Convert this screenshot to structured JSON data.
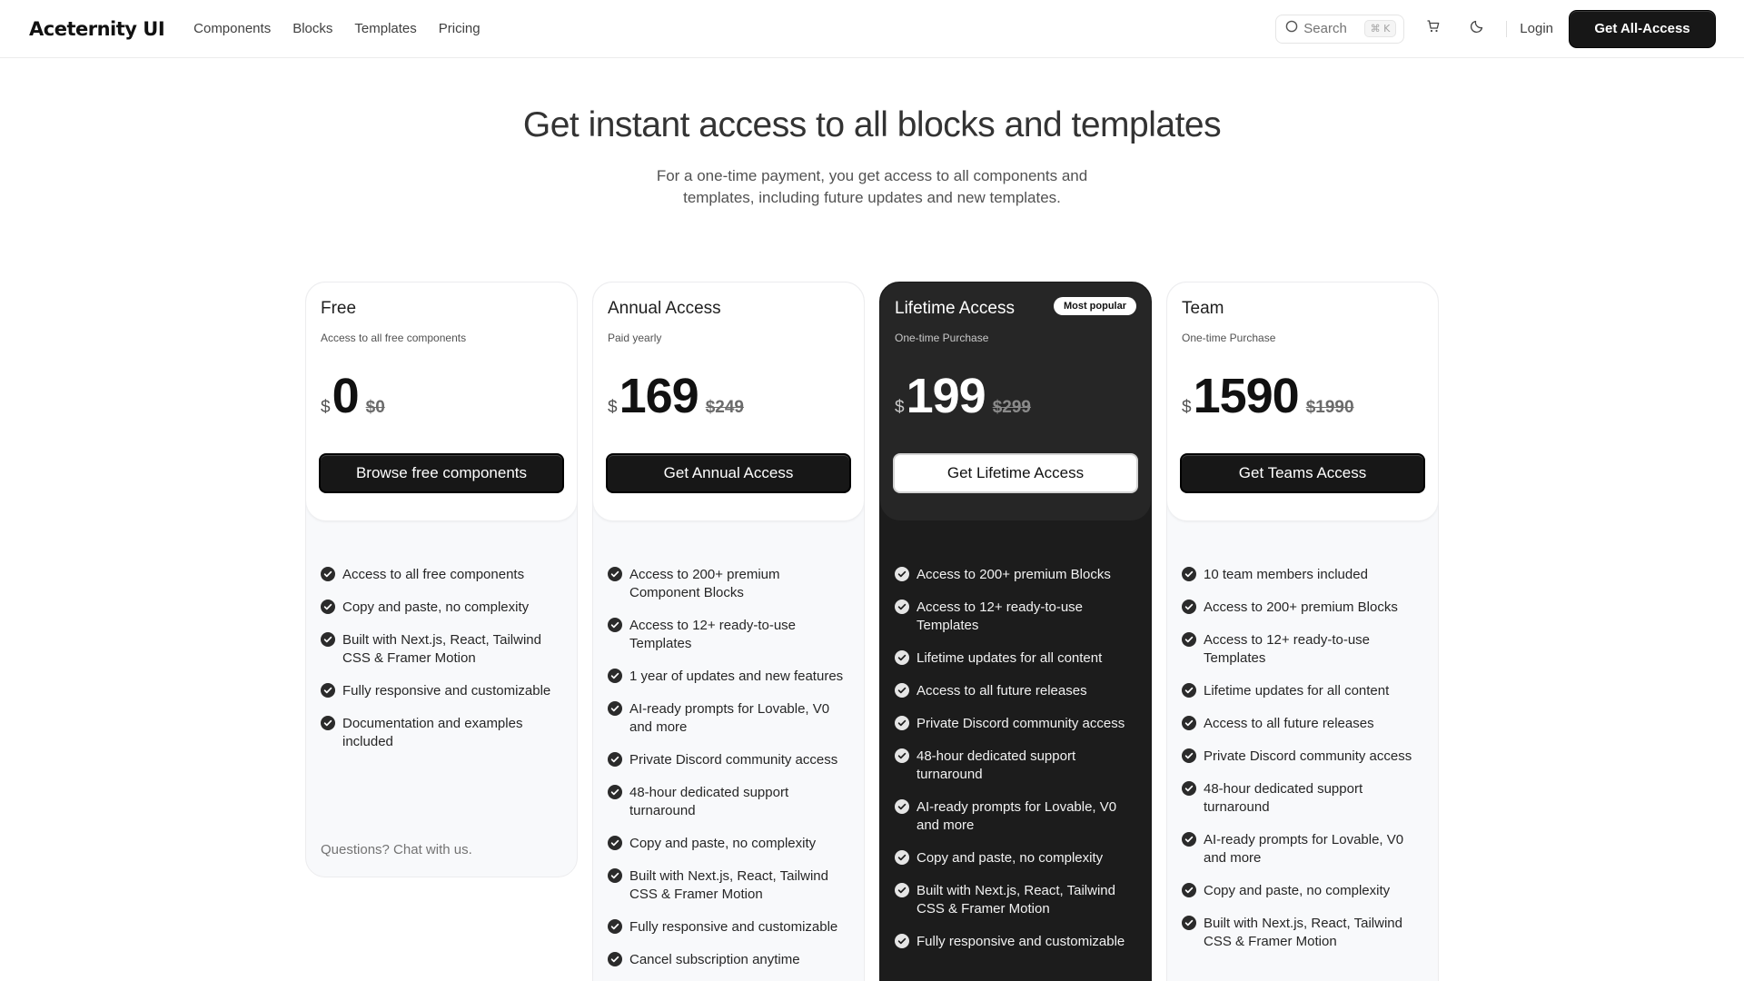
{
  "nav": {
    "logo": "Aceternity UI",
    "links": [
      "Components",
      "Blocks",
      "Templates",
      "Pricing"
    ],
    "search_label": "Search",
    "search_shortcut": "⌘ K",
    "login": "Login",
    "cta": "Get All-Access"
  },
  "hero": {
    "title": "Get instant access to all blocks and templates",
    "subtitle": "For a one-time payment, you get access to all components and templates, including future updates and new templates."
  },
  "plans": [
    {
      "name": "Free",
      "description": "Access to all free components",
      "currency": "$",
      "price": "0",
      "old_price": "$0",
      "button": "Browse free components",
      "features": [
        "Access to all free components",
        "Copy and paste, no complexity",
        "Built with Next.js, React, Tailwind CSS & Framer Motion",
        "Fully responsive and customizable",
        "Documentation and examples included"
      ],
      "footer": "Questions? Chat with us."
    },
    {
      "name": "Annual Access",
      "description": "Paid yearly",
      "currency": "$",
      "price": "169",
      "old_price": "$249",
      "button": "Get Annual Access",
      "features": [
        "Access to 200+ premium Component Blocks",
        "Access to 12+ ready-to-use Templates",
        "1 year of updates and new features",
        "AI-ready prompts for Lovable, V0 and more",
        "Private Discord community access",
        "48-hour dedicated support turnaround",
        "Copy and paste, no complexity",
        "Built with Next.js, React, Tailwind CSS & Framer Motion",
        "Fully responsive and customizable",
        "Cancel subscription anytime"
      ]
    },
    {
      "name": "Lifetime Access",
      "badge": "Most popular",
      "description": "One-time Purchase",
      "currency": "$",
      "price": "199",
      "old_price": "$299",
      "button": "Get Lifetime Access",
      "features": [
        "Access to 200+ premium Blocks",
        "Access to 12+ ready-to-use Templates",
        "Lifetime updates for all content",
        "Access to all future releases",
        "Private Discord community access",
        "48-hour dedicated support turnaround",
        "AI-ready prompts for Lovable, V0 and more",
        "Copy and paste, no complexity",
        "Built with Next.js, React, Tailwind CSS & Framer Motion",
        "Fully responsive and customizable"
      ]
    },
    {
      "name": "Team",
      "description": "One-time Purchase",
      "currency": "$",
      "price": "1590",
      "old_price": "$1990",
      "button": "Get Teams Access",
      "features": [
        "10 team members included",
        "Access to 200+ premium Blocks",
        "Access to 12+ ready-to-use Templates",
        "Lifetime updates for all content",
        "Access to all future releases",
        "Private Discord community access",
        "48-hour dedicated support turnaround",
        "AI-ready prompts for Lovable, V0 and more",
        "Copy and paste, no complexity",
        "Built with Next.js, React, Tailwind CSS & Framer Motion"
      ]
    }
  ],
  "colors": {
    "primary": "#171717",
    "highlight_card": "#1c1c1c",
    "card_bg": "#f8f9fb"
  }
}
